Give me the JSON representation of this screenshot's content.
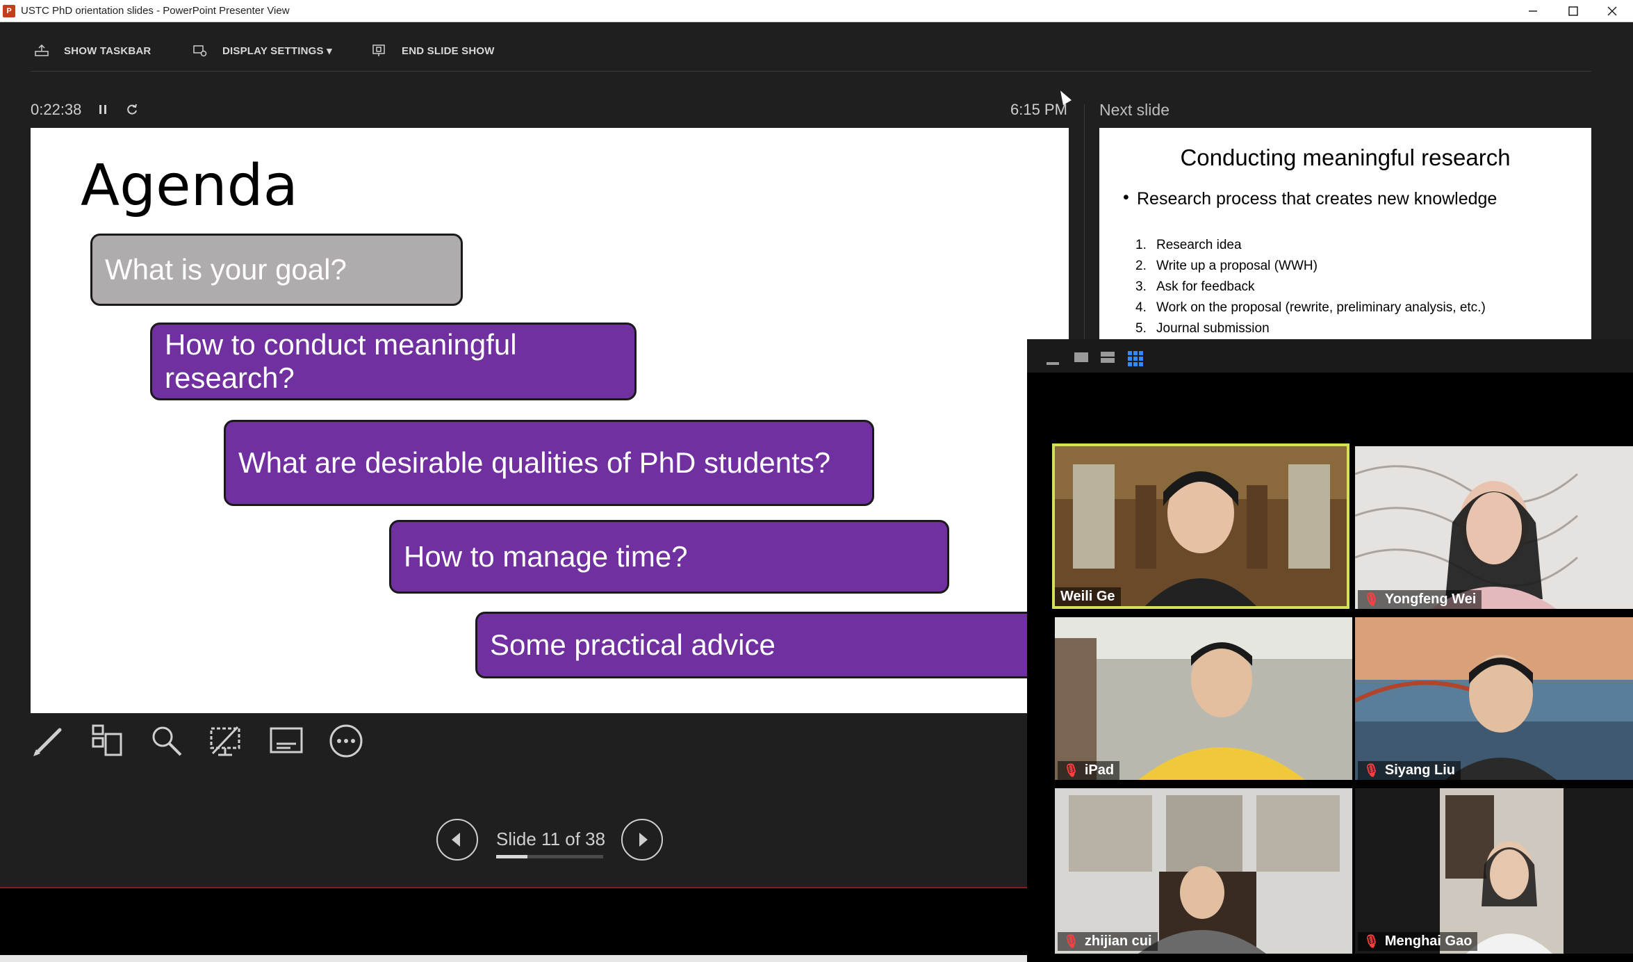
{
  "window": {
    "title": "USTC PhD orientation slides - PowerPoint Presenter View",
    "app_icon": "P"
  },
  "toolbar": {
    "show_taskbar": "SHOW TASKBAR",
    "display_settings": "DISPLAY SETTINGS ▾",
    "end_slide_show": "END SLIDE SHOW"
  },
  "timer": {
    "elapsed": "0:22:38",
    "clock": "6:15 PM"
  },
  "next_slide_label": "Next slide",
  "current_slide": {
    "title": "Agenda",
    "items": [
      "What is your goal?",
      "How to conduct meaningful research?",
      "What are desirable qualities of PhD students?",
      "How to manage time?",
      "Some practical advice"
    ]
  },
  "next_slide": {
    "title": "Conducting meaningful research",
    "bullet": "Research process that creates new knowledge",
    "steps": [
      {
        "num": "1.",
        "text": "Research idea"
      },
      {
        "num": "2.",
        "text": "Write up a proposal (WWH)"
      },
      {
        "num": "3.",
        "text": "Ask for feedback"
      },
      {
        "num": "4.",
        "text": "Work on the proposal (rewrite, preliminary analysis, etc.)"
      },
      {
        "num": "5.",
        "text": "Journal submission"
      }
    ]
  },
  "navigation": {
    "counter": "Slide 11 of 38",
    "progress": 0.29
  },
  "colors": {
    "purple_pill": "#7030a0",
    "gray_pill": "#b0abac",
    "active_speaker": "#d4e157"
  },
  "participants": [
    {
      "name": "Weili Ge",
      "muted": false,
      "active": true
    },
    {
      "name": "Yongfeng Wei",
      "muted": true,
      "active": false
    },
    {
      "name": "iPad",
      "muted": true,
      "active": false
    },
    {
      "name": "Siyang Liu",
      "muted": true,
      "active": false
    },
    {
      "name": "zhijian cui",
      "muted": true,
      "active": false
    },
    {
      "name": "Menghai Gao",
      "muted": true,
      "active": false
    }
  ]
}
